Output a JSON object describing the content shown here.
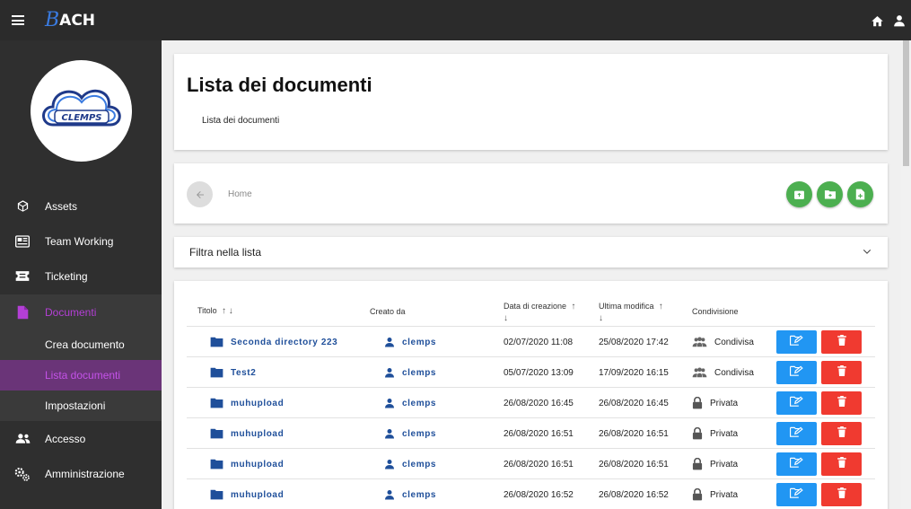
{
  "app": {
    "logo_text": "ACH",
    "logo_initial": "B"
  },
  "topbar_icons": [
    "menu-icon",
    "home-icon",
    "user-icon"
  ],
  "sidebar": {
    "avatar_text": "CLEMPS",
    "items": [
      {
        "label": "Assets",
        "icon": "cube-icon"
      },
      {
        "label": "Team Working",
        "icon": "newspaper-icon"
      },
      {
        "label": "Ticketing",
        "icon": "ticket-icon"
      },
      {
        "label": "Documenti",
        "icon": "file-icon"
      },
      {
        "label": "Accesso",
        "icon": "users-icon"
      },
      {
        "label": "Amministrazione",
        "icon": "cogs-icon"
      }
    ],
    "subitems": [
      {
        "label": "Crea documento"
      },
      {
        "label": "Lista documenti"
      },
      {
        "label": "Impostazioni"
      }
    ],
    "active_color": "#b43fd6"
  },
  "header": {
    "title": "Lista dei documenti",
    "subtitle": "Lista dei documenti"
  },
  "nav": {
    "crumb": "Home"
  },
  "filter": {
    "label": "Filtra nella lista"
  },
  "table": {
    "columns": {
      "title": "Titolo",
      "created_by": "Creato da",
      "created_at": "Data di creazione",
      "modified_at": "Ultima modifica",
      "sharing": "Condivisione"
    },
    "rows": [
      {
        "title": "Seconda directory 223",
        "owner": "clemps",
        "created": "02/07/2020 11:08",
        "modified": "25/08/2020 17:42",
        "sharing": "Condivisa",
        "sharing_icon": "group-icon"
      },
      {
        "title": "Test2",
        "owner": "clemps",
        "created": "05/07/2020 13:09",
        "modified": "17/09/2020 16:15",
        "sharing": "Condivisa",
        "sharing_icon": "group-icon"
      },
      {
        "title": "muhupload",
        "owner": "clemps",
        "created": "26/08/2020 16:45",
        "modified": "26/08/2020 16:45",
        "sharing": "Privata",
        "sharing_icon": "lock-icon"
      },
      {
        "title": "muhupload",
        "owner": "clemps",
        "created": "26/08/2020 16:51",
        "modified": "26/08/2020 16:51",
        "sharing": "Privata",
        "sharing_icon": "lock-icon"
      },
      {
        "title": "muhupload",
        "owner": "clemps",
        "created": "26/08/2020 16:51",
        "modified": "26/08/2020 16:51",
        "sharing": "Privata",
        "sharing_icon": "lock-icon"
      },
      {
        "title": "muhupload",
        "owner": "clemps",
        "created": "26/08/2020 16:52",
        "modified": "26/08/2020 16:52",
        "sharing": "Privata",
        "sharing_icon": "lock-icon"
      }
    ]
  },
  "colors": {
    "edit": "#2196f3",
    "delete": "#f03a30",
    "fab": "#4caf50",
    "link": "#1f4f9a"
  }
}
